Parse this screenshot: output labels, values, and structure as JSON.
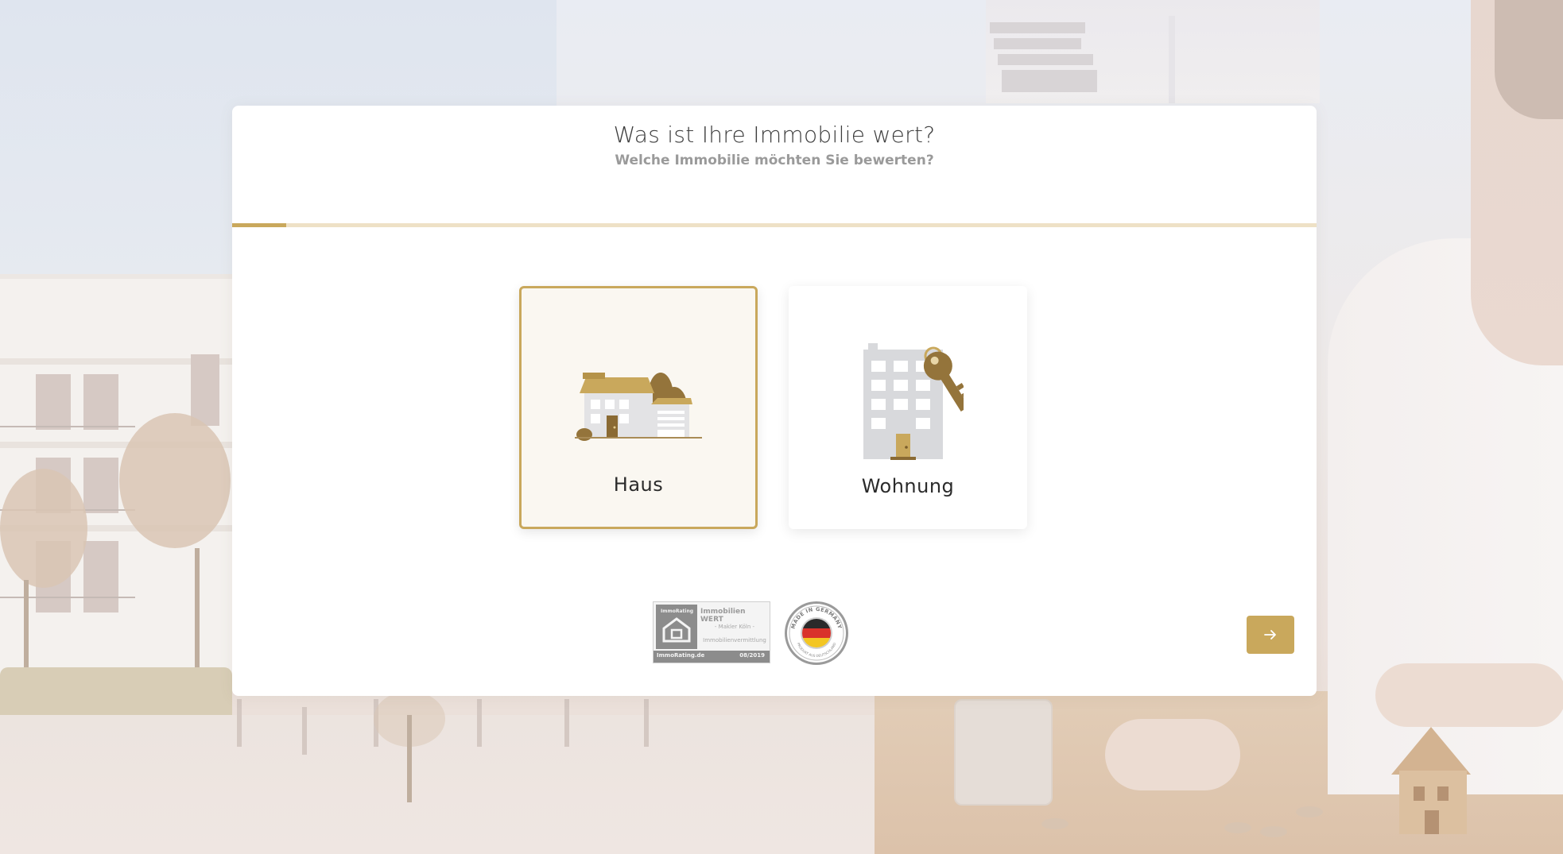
{
  "header": {
    "title": "Was ist Ihre Immobilie wert?",
    "subtitle": "Welche Immobilie möchten Sie bewerten?"
  },
  "progress": {
    "value": 0.05
  },
  "options": [
    {
      "id": "haus",
      "label": "Haus",
      "icon": "house-icon",
      "selected": true
    },
    {
      "id": "wohnung",
      "label": "Wohnung",
      "icon": "apartment-key-icon",
      "selected": false
    }
  ],
  "seals": {
    "immorating": {
      "brand": "ImmoRating",
      "title": "Immobilien WERT",
      "line1": "- Makler Köln -",
      "line2": "Immobilienvermittlung",
      "site": "ImmoRating.de",
      "date": "08/2019"
    },
    "made_in_germany": {
      "top_text": "MADE IN GERMANY",
      "bottom_text": "PRODUKT AUS DEUTSCHLAND"
    }
  },
  "navigation": {
    "next_icon": "arrow-right-icon"
  },
  "colors": {
    "accent": "#c9a85c",
    "accent_light": "#eee1c6",
    "selected_bg": "#faf7f1",
    "title_text": "#3d3d3d",
    "subtitle_text": "#9a9a9a"
  }
}
